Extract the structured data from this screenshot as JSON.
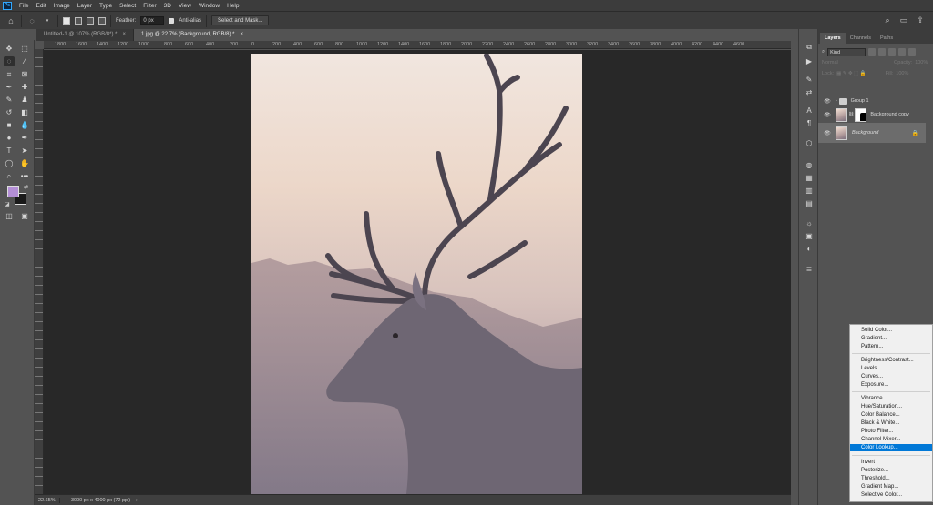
{
  "app": {
    "logo": "Ps"
  },
  "menubar": [
    "File",
    "Edit",
    "Image",
    "Layer",
    "Type",
    "Select",
    "Filter",
    "3D",
    "View",
    "Window",
    "Help"
  ],
  "options": {
    "feather_label": "Feather:",
    "feather_value": "0 px",
    "antialias_label": "Anti-alias",
    "select_mask_label": "Select and Mask..."
  },
  "tabs": [
    {
      "label": "Untitled-1 @ 107% (RGB/8*) *",
      "close": "×"
    },
    {
      "label": "1.jpg @ 22.7% (Background, RGB/8) *",
      "close": "×"
    }
  ],
  "ruler_ticks": [
    "1800",
    "1600",
    "1400",
    "1200",
    "1000",
    "800",
    "600",
    "400",
    "200",
    "0",
    "200",
    "400",
    "600",
    "800",
    "1000",
    "1200",
    "1400",
    "1600",
    "1800",
    "2000",
    "2200",
    "2400",
    "2600",
    "2800",
    "3000",
    "3200",
    "3400",
    "3600",
    "3800",
    "4000",
    "4200",
    "4400",
    "4600"
  ],
  "status": {
    "zoom": "22.65%",
    "doc_info": "3000 px x 4000 px (72 ppi)"
  },
  "colors": {
    "foreground": "#b48fd6",
    "background": "#1a1a1a",
    "accent": "#0078d7"
  },
  "layers_panel": {
    "tabs": [
      "Layers",
      "Channels",
      "Paths"
    ],
    "kind": "Kind",
    "blend_mode": "Normal",
    "opacity_label": "Opacity:",
    "opacity_value": "100%",
    "lock_label": "Lock:",
    "fill_label": "Fill:",
    "fill_value": "100%",
    "layers": [
      {
        "name": "Group 1",
        "type": "group"
      },
      {
        "name": "Background copy",
        "type": "masked"
      },
      {
        "name": "Background",
        "type": "locked",
        "selected": true
      }
    ]
  },
  "adjustment_menu": {
    "groups": [
      [
        "Solid Color...",
        "Gradient...",
        "Pattern..."
      ],
      [
        "Brightness/Contrast...",
        "Levels...",
        "Curves...",
        "Exposure..."
      ],
      [
        "Vibrance...",
        "Hue/Saturation...",
        "Color Balance...",
        "Black & White...",
        "Photo Filter...",
        "Channel Mixer...",
        "Color Lookup..."
      ],
      [
        "Invert",
        "Posterize...",
        "Threshold...",
        "Gradient Map...",
        "Selective Color..."
      ]
    ],
    "highlighted": "Color Lookup..."
  }
}
